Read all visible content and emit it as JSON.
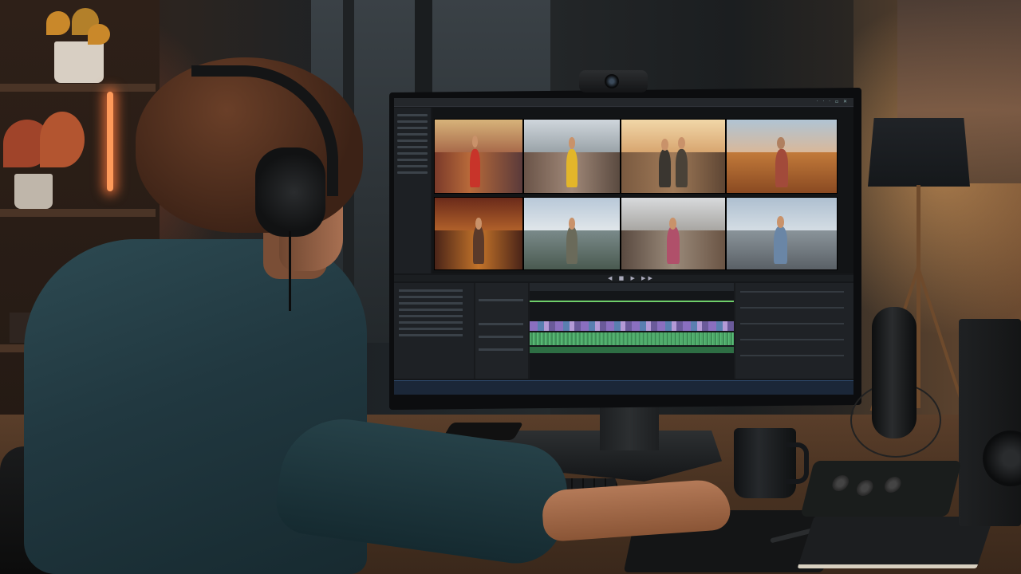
{
  "scene": {
    "kind": "photo",
    "subject": "video-editor-workstation"
  },
  "colors": {
    "timeline_video": "#8a6fbf",
    "timeline_audio": "#4fa86a",
    "status_bar": "#1b2738",
    "neon_accent": "#ff9a5a"
  },
  "screen": {
    "menu_icons": "· · · ▫ ✕",
    "transport_glyphs": "◀ ■ ▶ ▶▶"
  }
}
